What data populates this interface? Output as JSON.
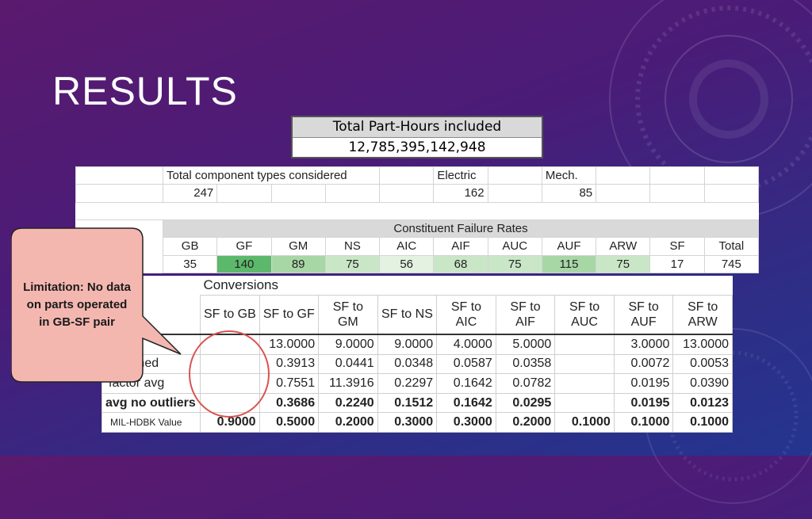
{
  "slide": {
    "title": "RESULTS"
  },
  "part_hours": {
    "header": "Total Part-Hours included",
    "value": "12,785,395,142,948"
  },
  "components": {
    "types_label": "Total component types considered",
    "types_value": "247",
    "electric_label": "Electric",
    "electric_value": "162",
    "mech_label": "Mech.",
    "mech_value": "85",
    "rates_title": "Constituent Failure Rates",
    "columns": [
      "GB",
      "GF",
      "GM",
      "NS",
      "AIC",
      "AIF",
      "AUC",
      "AUF",
      "ARW",
      "SF",
      "Total"
    ],
    "values": [
      "35",
      "140",
      "89",
      "75",
      "56",
      "68",
      "75",
      "115",
      "75",
      "17",
      "745"
    ]
  },
  "conversions": {
    "title": "Conversions",
    "columns": [
      [
        "SF to GB",
        ""
      ],
      [
        "SF to GF",
        ""
      ],
      [
        "SF to",
        "GM"
      ],
      [
        "SF to NS",
        ""
      ],
      [
        "SF to",
        "AIC"
      ],
      [
        "SF to",
        "AIF"
      ],
      [
        "SF to",
        "AUC"
      ],
      [
        "SF to",
        "AUF"
      ],
      [
        "SF to",
        "ARW"
      ]
    ],
    "rows": [
      {
        "label": "",
        "values": [
          "",
          "13.0000",
          "9.0000",
          "9.0000",
          "4.0000",
          "5.0000",
          "",
          "3.0000",
          "13.0000"
        ]
      },
      {
        "label": "med",
        "values": [
          "",
          "0.3913",
          "0.0441",
          "0.0348",
          "0.0587",
          "0.0358",
          "",
          "0.0072",
          "0.0053"
        ]
      },
      {
        "label": "factor avg",
        "values": [
          "",
          "0.7551",
          "11.3916",
          "0.2297",
          "0.1642",
          "0.0782",
          "",
          "0.0195",
          "0.0390"
        ]
      },
      {
        "label": "avg no outliers",
        "values": [
          "",
          "0.3686",
          "0.2240",
          "0.1512",
          "0.1642",
          "0.0295",
          "",
          "0.0195",
          "0.0123"
        ]
      },
      {
        "label": "MIL-HDBK Value",
        "values": [
          "0.9000",
          "0.5000",
          "0.2000",
          "0.3000",
          "0.3000",
          "0.2000",
          "0.1000",
          "0.1000",
          "0.1000"
        ]
      }
    ]
  },
  "callout": {
    "text": "Limitation: No data on parts operated in GB-SF pair"
  },
  "colors": {
    "callout_fill": "#f4b7b0",
    "circle": "#d9534f",
    "highlight_dark": "#5cb86a",
    "highlight_light": "#c9e7c7"
  }
}
